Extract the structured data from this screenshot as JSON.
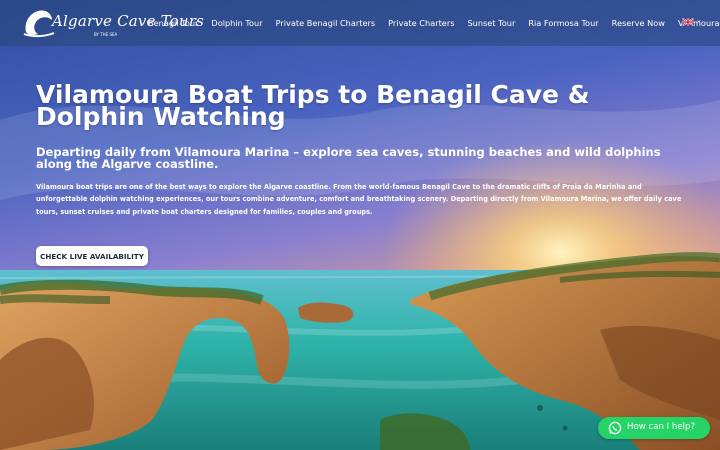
{
  "logo": {
    "name": "Algarve Cave Tours",
    "tagline": "BY THE SEA"
  },
  "nav": {
    "items": [
      {
        "label": "Benagil Tour"
      },
      {
        "label": "Dolphin Tour"
      },
      {
        "label": "Private Benagil Charters"
      },
      {
        "label": "Private Charters"
      },
      {
        "label": "Sunset Tour"
      },
      {
        "label": "Ria Formosa Tour"
      },
      {
        "label": "Reserve Now"
      },
      {
        "label": "Vilamoura Guide",
        "has_dropdown": true
      }
    ],
    "language_flag": "uk-flag-icon"
  },
  "hero": {
    "title": "Vilamoura Boat Trips to Benagil Cave & Dolphin Watching",
    "subtitle": "Departing daily from Vilamoura Marina – explore sea caves, stunning beaches and wild dolphins along the Algarve coastline.",
    "intro": "Vilamoura boat trips are one of the best ways to explore the Algarve coastline. From the world-famous Benagil Cave to the dramatic cliffs of Praia da Marinha and unforgettable dolphin watching experiences, our tours combine adventure, comfort and breathtaking scenery. Departing directly from Vilamoura Marina, we offer daily cave tours, sunset cruises and private boat charters designed for families, couples and groups.",
    "cta_label": "CHECK LIVE AVAILABILITY"
  },
  "whatsapp": {
    "label": "How can I help?",
    "color": "#25d366"
  },
  "colors": {
    "sky_top": "#3b5fb8",
    "sea": "#2fb3a8",
    "cliff": "#c98a4a"
  }
}
